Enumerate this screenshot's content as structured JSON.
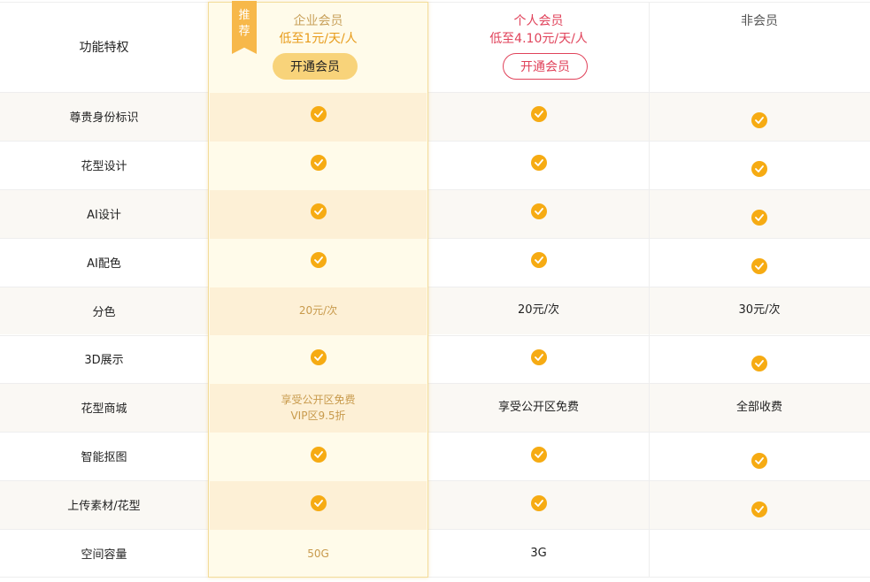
{
  "header": {
    "feature_column": "功能特权",
    "enterprise": {
      "badge_line1": "推",
      "badge_line2": "荐",
      "title": "企业会员",
      "price": "低至1元/天/人",
      "button": "开通会员"
    },
    "personal": {
      "title": "个人会员",
      "price": "低至4.10元/天/人",
      "button": "开通会员"
    },
    "non_member": {
      "title": "非会员"
    }
  },
  "icons": {
    "check": "check-circle-icon"
  },
  "colors": {
    "accent_gold": "#f6ab13",
    "enterprise_bg": "#fffbea",
    "personal_red": "#e0425a"
  },
  "rows": [
    {
      "feature": "尊贵身份标识",
      "enterprise": "check",
      "personal": "check",
      "non_member": "check"
    },
    {
      "feature": "花型设计",
      "enterprise": "check",
      "personal": "check",
      "non_member": "check"
    },
    {
      "feature": "AI设计",
      "enterprise": "check",
      "personal": "check",
      "non_member": "check"
    },
    {
      "feature": "AI配色",
      "enterprise": "check",
      "personal": "check",
      "non_member": "check"
    },
    {
      "feature": "分色",
      "enterprise": "20元/次",
      "personal": "20元/次",
      "non_member": "30元/次"
    },
    {
      "feature": "3D展示",
      "enterprise": "check",
      "personal": "check",
      "non_member": "check"
    },
    {
      "feature": "花型商城",
      "enterprise": "享受公开区免费\nVIP区9.5折",
      "personal": "享受公开区免费",
      "non_member": "全部收费"
    },
    {
      "feature": "智能抠图",
      "enterprise": "check",
      "personal": "check",
      "non_member": "check"
    },
    {
      "feature": "上传素材/花型",
      "enterprise": "check",
      "personal": "check",
      "non_member": "check"
    },
    {
      "feature": "空间容量",
      "enterprise": "50G",
      "personal": "3G",
      "non_member": ""
    }
  ]
}
